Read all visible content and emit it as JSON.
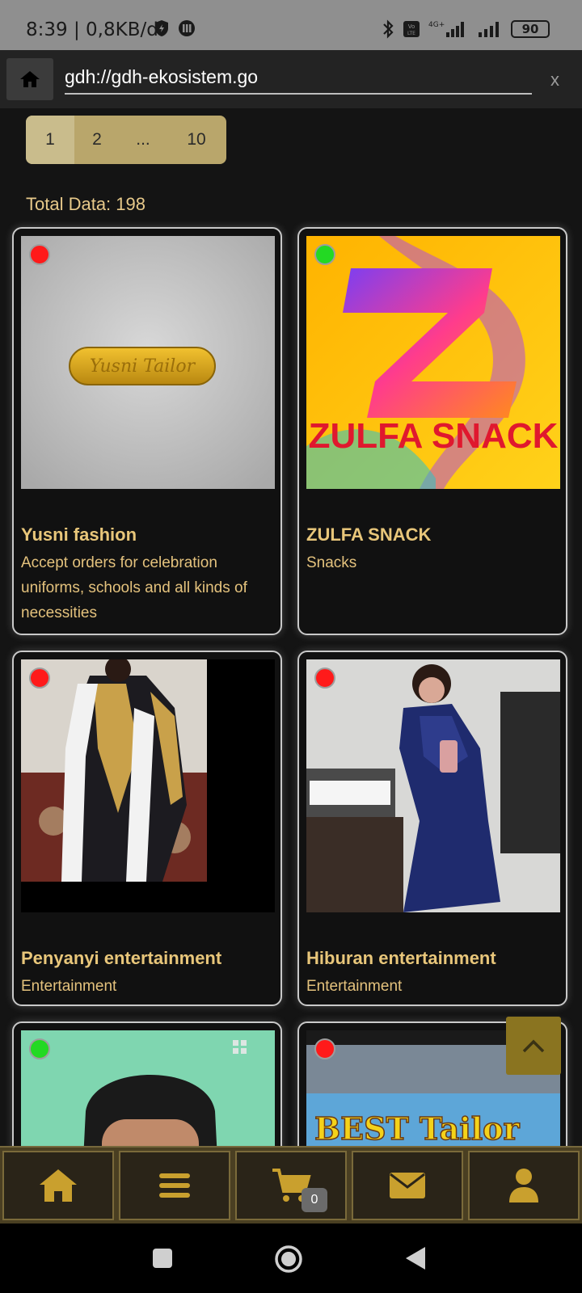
{
  "status_bar": {
    "time": "8:39",
    "network_speed": "| 0,8KB/d",
    "battery": "90"
  },
  "browser": {
    "url": "gdh://gdh-ekosistem.go",
    "close_label": "x"
  },
  "pagination": {
    "pages": [
      "1",
      "2",
      "...",
      "10"
    ],
    "active_page": "1"
  },
  "total_data": "Total Data: 198",
  "cards": [
    {
      "title": "Yusni fashion",
      "description": "Accept orders for celebration uniforms, schools and all kinds of necessities",
      "status": "red",
      "image_text": "Yusni Tailor"
    },
    {
      "title": "ZULFA SNACK",
      "description": "Snacks",
      "status": "green",
      "image_text": "ZULFA SNACK"
    },
    {
      "title": "Penyanyi entertainment",
      "description": "Entertainment",
      "status": "red"
    },
    {
      "title": "Hiburan entertainment",
      "description": "Entertainment",
      "status": "red"
    },
    {
      "title": "",
      "description": "",
      "status": "green"
    },
    {
      "title": "",
      "description": "",
      "status": "red",
      "image_text": "BEST Tailor"
    }
  ],
  "bottom_nav": {
    "items": [
      "home-icon",
      "menu-icon",
      "cart-icon",
      "mail-icon",
      "user-icon"
    ],
    "cart_count": "0"
  },
  "colors": {
    "accent_gold": "#e7c98a",
    "nav_bg": "#4a3f22",
    "to_top_bg": "#8a7420",
    "status_online": "#23d923",
    "status_offline": "#ff1a1a"
  }
}
